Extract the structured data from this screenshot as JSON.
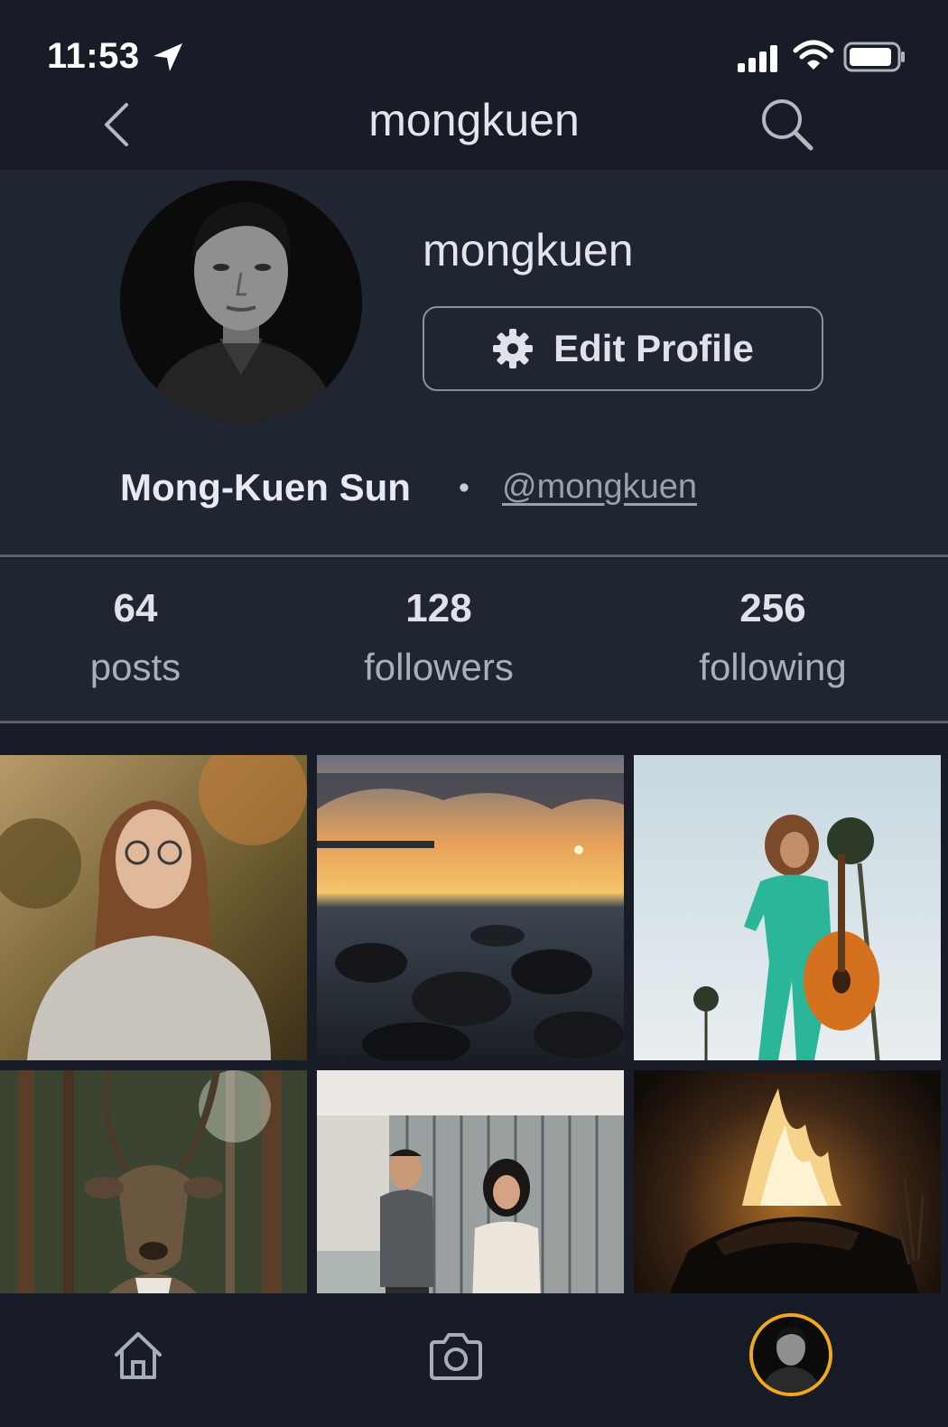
{
  "status_bar": {
    "time": "11:53",
    "icons": [
      "location-arrow-icon",
      "cellular-signal-icon",
      "wifi-icon",
      "battery-icon"
    ]
  },
  "nav": {
    "title": "mongkuen",
    "back_icon": "chevron-left-icon",
    "search_icon": "search-icon"
  },
  "profile": {
    "username": "mongkuen",
    "edit_button_label": "Edit Profile",
    "edit_button_icon": "gear-icon",
    "full_name": "Mong-Kuen Sun",
    "separator": "•",
    "handle": "@mongkuen"
  },
  "stats": [
    {
      "count": "64",
      "label": "posts"
    },
    {
      "count": "128",
      "label": "followers"
    },
    {
      "count": "256",
      "label": "following"
    }
  ],
  "posts": [
    {
      "subject": "woman-portrait-autumn"
    },
    {
      "subject": "sunset-rocky-shore"
    },
    {
      "subject": "guitarist-palm-trees"
    },
    {
      "subject": "reindeer-forest"
    },
    {
      "subject": "couple-building"
    },
    {
      "subject": "campfire-night"
    }
  ],
  "tab_bar": {
    "items": [
      "home-icon",
      "camera-icon",
      "profile-avatar"
    ],
    "active": "profile-avatar",
    "active_ring_color": "#f0a91c"
  },
  "colors": {
    "background": "#171c26",
    "panel": "#1f2531",
    "accent": "#f0a91c"
  }
}
